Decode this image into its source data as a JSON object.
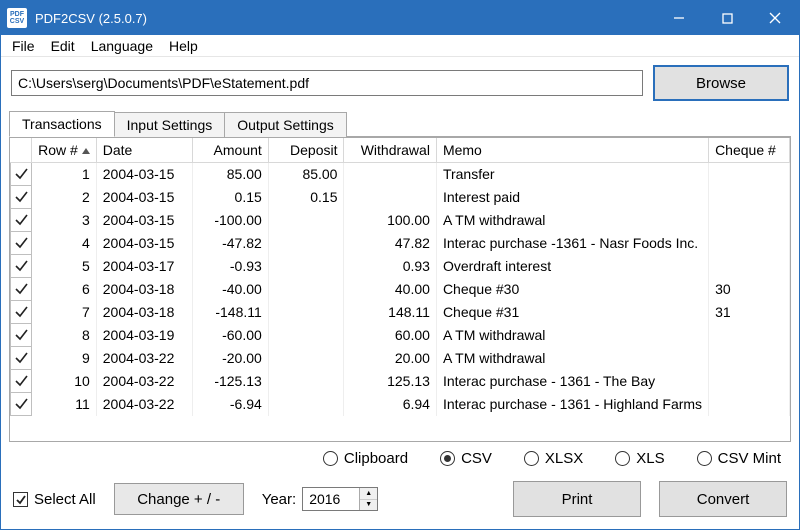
{
  "window": {
    "title": "PDF2CSV (2.5.0.7)",
    "icon_top": "PDF",
    "icon_bot": "CSV"
  },
  "menu": {
    "file": "File",
    "edit": "Edit",
    "language": "Language",
    "help": "Help"
  },
  "filerow": {
    "path": "C:\\Users\\serg\\Documents\\PDF\\eStatement.pdf",
    "browse": "Browse"
  },
  "tabs": {
    "transactions": "Transactions",
    "input_settings": "Input Settings",
    "output_settings": "Output Settings"
  },
  "columns": {
    "row": "Row #",
    "date": "Date",
    "amount": "Amount",
    "deposit": "Deposit",
    "withdrawal": "Withdrawal",
    "memo": "Memo",
    "cheque": "Cheque #"
  },
  "rows": [
    {
      "n": "1",
      "date": "2004-03-15",
      "amount": "85.00",
      "deposit": "85.00",
      "withdrawal": "",
      "memo": "Transfer",
      "cheque": ""
    },
    {
      "n": "2",
      "date": "2004-03-15",
      "amount": "0.15",
      "deposit": "0.15",
      "withdrawal": "",
      "memo": "Interest paid",
      "cheque": ""
    },
    {
      "n": "3",
      "date": "2004-03-15",
      "amount": "-100.00",
      "deposit": "",
      "withdrawal": "100.00",
      "memo": "A TM withdrawal",
      "cheque": ""
    },
    {
      "n": "4",
      "date": "2004-03-15",
      "amount": "-47.82",
      "deposit": "",
      "withdrawal": "47.82",
      "memo": "Interac purchase -1361 - Nasr Foods Inc.",
      "cheque": ""
    },
    {
      "n": "5",
      "date": "2004-03-17",
      "amount": "-0.93",
      "deposit": "",
      "withdrawal": "0.93",
      "memo": "Overdraft interest",
      "cheque": ""
    },
    {
      "n": "6",
      "date": "2004-03-18",
      "amount": "-40.00",
      "deposit": "",
      "withdrawal": "40.00",
      "memo": "Cheque #30",
      "cheque": "30"
    },
    {
      "n": "7",
      "date": "2004-03-18",
      "amount": "-148.11",
      "deposit": "",
      "withdrawal": "148.11",
      "memo": "Cheque #31",
      "cheque": "31"
    },
    {
      "n": "8",
      "date": "2004-03-19",
      "amount": "-60.00",
      "deposit": "",
      "withdrawal": "60.00",
      "memo": "A TM withdrawal",
      "cheque": ""
    },
    {
      "n": "9",
      "date": "2004-03-22",
      "amount": "-20.00",
      "deposit": "",
      "withdrawal": "20.00",
      "memo": "A TM withdrawal",
      "cheque": ""
    },
    {
      "n": "10",
      "date": "2004-03-22",
      "amount": "-125.13",
      "deposit": "",
      "withdrawal": "125.13",
      "memo": "Interac purchase - 1361 - The Bay",
      "cheque": ""
    },
    {
      "n": "11",
      "date": "2004-03-22",
      "amount": "-6.94",
      "deposit": "",
      "withdrawal": "6.94",
      "memo": "Interac purchase - 1361 - Highland Farms",
      "cheque": ""
    }
  ],
  "radios": {
    "clipboard": "Clipboard",
    "csv": "CSV",
    "xlsx": "XLSX",
    "xls": "XLS",
    "csv_mint": "CSV Mint",
    "selected": "csv"
  },
  "actions": {
    "select_all": "Select All",
    "change_sign": "Change + / -",
    "year_label": "Year:",
    "year_value": "2016",
    "print": "Print",
    "convert": "Convert"
  }
}
